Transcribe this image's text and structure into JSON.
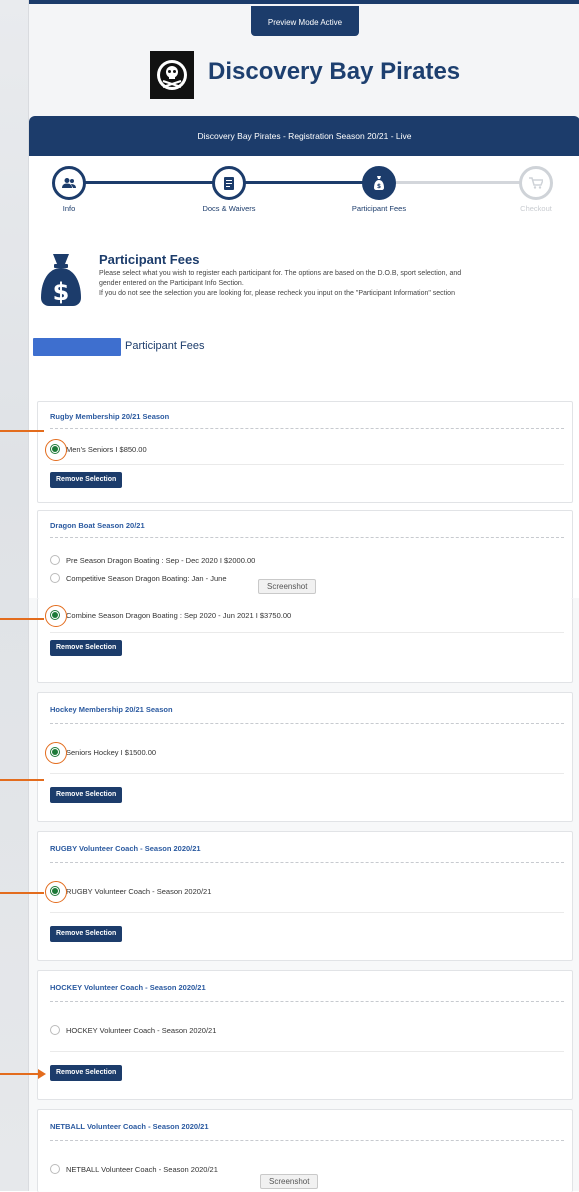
{
  "preview_badge": "Preview Mode Active",
  "club_name": "Discovery Bay Pirates",
  "registration_bar": "Discovery Bay Pirates - Registration Season 20/21 - Live",
  "steps": [
    {
      "label": "Info",
      "state": "done"
    },
    {
      "label": "Docs & Waivers",
      "state": "done"
    },
    {
      "label": "Participant Fees",
      "state": "active"
    },
    {
      "label": "Checkout",
      "state": "disabled"
    }
  ],
  "fees_header": {
    "title": "Participant Fees",
    "line1": "Please select what you wish to register each participant for. The options are based on the D.O.B, sport selection, and",
    "line2": "gender entered on the Participant Info Section.",
    "line3": "If you do not see the selection you are looking for, please recheck you input on the \"Participant Information\" section"
  },
  "section_title": "Participant Fees",
  "remove_label": "Remove Selection",
  "tooltip_label": "Screenshot",
  "cards": [
    {
      "title": "Rugby Membership 20/21 Season",
      "options": [
        {
          "label": "Men's Seniors I $850.00",
          "checked": true
        }
      ]
    },
    {
      "title": "Dragon Boat Season 20/21",
      "options": [
        {
          "label": "Pre Season Dragon Boating : Sep - Dec 2020 I $2000.00",
          "checked": false
        },
        {
          "label": "Competitive Season Dragon Boating: Jan - June",
          "checked": false
        },
        {
          "label": "Combine Season Dragon Boating : Sep 2020 - Jun 2021 I $3750.00",
          "checked": true
        }
      ]
    },
    {
      "title": "Hockey Membership 20/21 Season",
      "options": [
        {
          "label": "Seniors Hockey I $1500.00",
          "checked": true
        }
      ]
    },
    {
      "title": "RUGBY Volunteer Coach - Season 2020/21",
      "options": [
        {
          "label": "RUGBY Volunteer Coach - Season 2020/21",
          "checked": true
        }
      ]
    },
    {
      "title": "HOCKEY Volunteer Coach - Season 2020/21",
      "options": [
        {
          "label": "HOCKEY Volunteer Coach - Season 2020/21",
          "checked": false
        }
      ]
    },
    {
      "title": "NETBALL Volunteer Coach - Season 2020/21",
      "options": [
        {
          "label": "NETBALL Volunteer Coach - Season 2020/21",
          "checked": false
        }
      ]
    }
  ],
  "colors": {
    "navy": "#1c3c6b",
    "accent_orange": "#e36c1d",
    "link_blue": "#2b5aa0",
    "check_green": "#1c7a38"
  }
}
